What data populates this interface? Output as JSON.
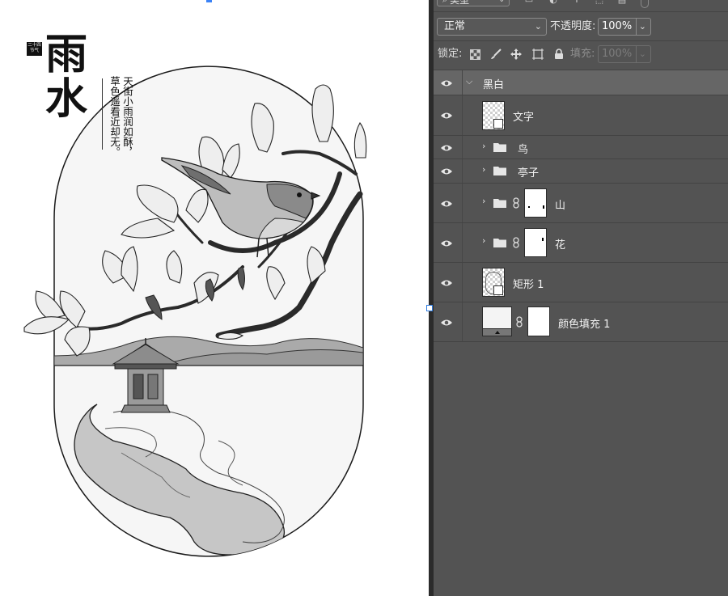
{
  "canvas": {
    "title_chars": [
      "雨",
      "水"
    ],
    "seal_text": [
      "二十四",
      "节气"
    ],
    "poem_columns": [
      "天街小雨润如酥，",
      "草色遥看近却无。"
    ]
  },
  "panel": {
    "filter": {
      "kind_label": "类型"
    },
    "blend_mode": "正常",
    "opacity_label": "不透明度:",
    "opacity_value": "100%",
    "lock_label": "锁定:",
    "fill_label": "填充:",
    "fill_value": "100%",
    "layers": [
      {
        "name": "黑白",
        "kind": "group",
        "expanded": true
      },
      {
        "name": "文字",
        "kind": "smart-object"
      },
      {
        "name": "鸟",
        "kind": "group"
      },
      {
        "name": "亭子",
        "kind": "group"
      },
      {
        "name": "山",
        "kind": "group-with-mask"
      },
      {
        "name": "花",
        "kind": "group-with-mask"
      },
      {
        "name": "矩形 1",
        "kind": "shape"
      },
      {
        "name": "颜色填充 1",
        "kind": "fill-with-mask"
      }
    ]
  },
  "colors": {
    "panel_bg": "#535353",
    "row_highlight": "#666666",
    "canvas_bg": "#ffffff",
    "selection_blue": "#2d7be0"
  }
}
